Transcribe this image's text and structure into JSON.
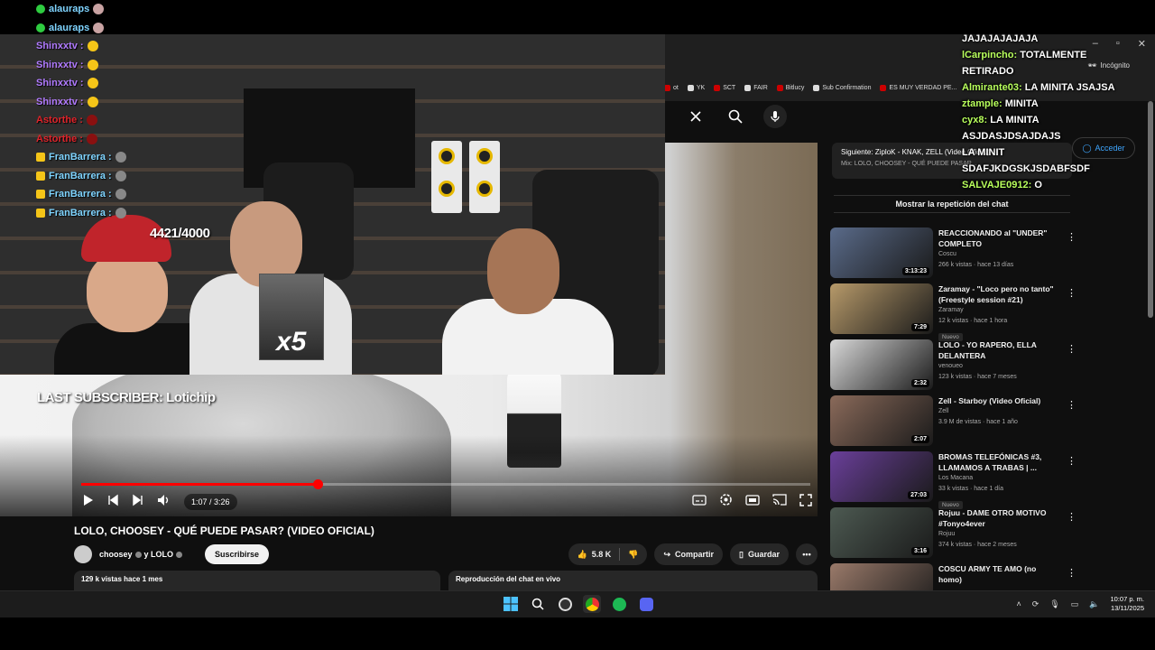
{
  "bookmarks": [
    "ot",
    "YK",
    "SCT",
    "FAIR",
    "Bitlucy",
    "Sub Confirmation",
    "ES MUY VERDAD PE..."
  ],
  "browser": {
    "incognito_label": "Incógnito",
    "acceder_label": "Acceder"
  },
  "overlay": {
    "sub_counter": "4421/4000",
    "last_subscriber": "LAST SUBSCRIBER: Lotichip",
    "x5_label": "x5"
  },
  "left_chat": [
    {
      "user": "alauraps",
      "color": "#7fd4ff",
      "badge": "#2ecc40",
      "emote": "#c9a3a3"
    },
    {
      "user": "alauraps",
      "color": "#7fd4ff",
      "badge": "#2ecc40",
      "emote": "#c9a3a3"
    },
    {
      "user": "Shinxxtv :",
      "color": "#b07aff",
      "badge": "",
      "emote": "#f5c518"
    },
    {
      "user": "Shinxxtv :",
      "color": "#b07aff",
      "badge": "",
      "emote": "#f5c518"
    },
    {
      "user": "Shinxxtv :",
      "color": "#b07aff",
      "badge": "",
      "emote": "#f5c518"
    },
    {
      "user": "Shinxxtv :",
      "color": "#b07aff",
      "badge": "",
      "emote": "#f5c518"
    },
    {
      "user": "Astorthe :",
      "color": "#e0242b",
      "badge": "",
      "emote": "#8a1010"
    },
    {
      "user": "Astorthe :",
      "color": "#e0242b",
      "badge": "",
      "emote": "#8a1010"
    },
    {
      "user": "FranBarrera :",
      "color": "#7fd4ff",
      "badge": "#f5c518",
      "emote": "#888888"
    },
    {
      "user": "FranBarrera :",
      "color": "#7fd4ff",
      "badge": "#f5c518",
      "emote": "#888888"
    },
    {
      "user": "FranBarrera :",
      "color": "#7fd4ff",
      "badge": "#f5c518",
      "emote": "#888888"
    },
    {
      "user": "FranBarrera :",
      "color": "#7fd4ff",
      "badge": "#f5c518",
      "emote": "#888888"
    }
  ],
  "right_chat": [
    {
      "user": "",
      "msg": "JAJAJAJAJAJA"
    },
    {
      "user": "lCarpincho:",
      "msg": "TOTALMENTE"
    },
    {
      "user": "",
      "msg": "RETIRADO"
    },
    {
      "user": "Almirante03:",
      "msg": "LA MINITA JSAJSA"
    },
    {
      "user": "ztample:",
      "msg": "MINITA"
    },
    {
      "user": "cyx8:",
      "msg": "LA MINITA"
    },
    {
      "user": "",
      "msg": "ASJDASJDSAJDAJS"
    },
    {
      "user": "",
      "msg": "LA MINIT"
    },
    {
      "user": "",
      "msg": "SDAFJKDGSKJSDABFSDF"
    },
    {
      "user": "SALVAJE0912:",
      "msg": "O"
    }
  ],
  "player": {
    "time": "1:07 / 3:26",
    "progress": 0.324
  },
  "video": {
    "title": "LOLO, CHOOSEY - QUÉ PUEDE PASAR? (VIDEO OFICIAL)",
    "channel": "choosey",
    "channel_and": "y LOLO",
    "subscribe_label": "Suscribirse",
    "likes": "5.8 K",
    "share_label": "Compartir",
    "save_label": "Guardar",
    "views": "129 k vistas  hace 1 mes",
    "chat_replay": "Reproducción del chat en vivo"
  },
  "up_next": {
    "line1": "Siguiente: ZiploK - KNAK, ZELL (Video Oficial)",
    "line2": "Mix: LOLO, CHOOSEY - QUÉ PUEDE PASAR..."
  },
  "replay_button": "Mostrar la repetición del chat",
  "recommendations": [
    {
      "title": "REACCIONANDO al \"UNDER\" COMPLETO",
      "channel": "Coscu",
      "meta": "266 k vistas · hace 13 días",
      "duration": "3:13:23",
      "nuevo": "",
      "thumb": "#5a6b8a"
    },
    {
      "title": "Zaramay - \"Loco pero no tanto\" (Freestyle session #21)",
      "channel": "Zaramay",
      "meta": "12 k vistas · hace 1 hora",
      "duration": "7:29",
      "nuevo": "Nuevo",
      "thumb": "#b79a6a"
    },
    {
      "title": "LOLO - YO RAPERO, ELLA DELANTERA",
      "channel": "venoueo",
      "meta": "123 k vistas · hace 7 meses",
      "duration": "2:32",
      "nuevo": "",
      "thumb": "#d8d8d8"
    },
    {
      "title": "Zell - Starboy (Video Oficial)",
      "channel": "Zell",
      "meta": "3.9 M de vistas · hace 1 año",
      "duration": "2:07",
      "nuevo": "",
      "thumb": "#8a6a5a"
    },
    {
      "title": "BROMAS TELEFÓNICAS #3, LLAMAMOS A TRABAS | ...",
      "channel": "Los Macana",
      "meta": "33 k vistas · hace 1 día",
      "duration": "27:03",
      "nuevo": "Nuevo",
      "thumb": "#6a3f9a"
    },
    {
      "title": "Rojuu - DAME OTRO MOTIVO #Tonyo4ever",
      "channel": "Rojuu",
      "meta": "374 k vistas · hace 2 meses",
      "duration": "3:16",
      "nuevo": "",
      "thumb": "#4d5a52"
    },
    {
      "title": "COSCU ARMY TE AMO (no homo)",
      "channel": "",
      "meta": "",
      "duration": "",
      "nuevo": "",
      "thumb": "#9a7a6a"
    }
  ],
  "taskbar": {
    "time": "10:07 p. m.",
    "date": "13/11/2025"
  }
}
